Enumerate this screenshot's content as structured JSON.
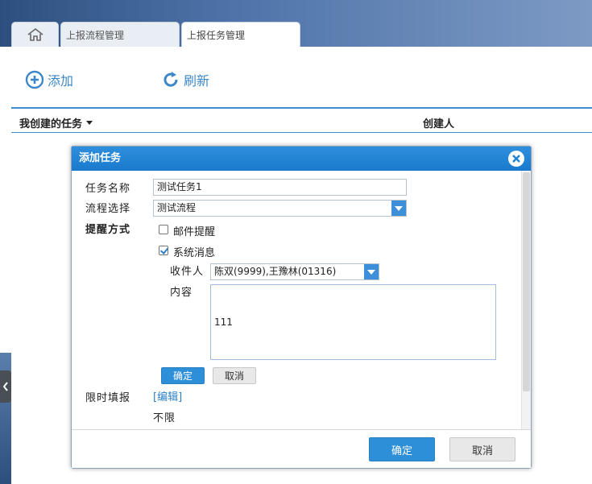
{
  "tabs": [
    {
      "label": "",
      "icon": "home-icon"
    },
    {
      "label": "上报流程管理"
    },
    {
      "label": "上报任务管理"
    }
  ],
  "toolbar": {
    "add_label": "添加",
    "refresh_label": "刷新"
  },
  "table": {
    "headers": [
      "我创建的任务",
      "创建人"
    ]
  },
  "dialog": {
    "title": "添加任务",
    "fields": {
      "task_name_label": "任务名称",
      "task_name_value": "测试任务1",
      "flow_label": "流程选择",
      "flow_value": "测试流程",
      "reminder_label": "提醒方式",
      "email_label": "邮件提醒",
      "email_checked": false,
      "system_label": "系统消息",
      "system_checked": true,
      "recipient_label": "收件人",
      "recipient_value": "陈双(9999),王豫林(01316)",
      "content_label": "内容",
      "content_value": "111"
    },
    "inner_buttons": {
      "ok": "确定",
      "cancel": "取消"
    },
    "time_limit": {
      "label": "限时填报",
      "edit_link": "[编辑]",
      "value": "不限"
    },
    "footer_buttons": {
      "ok": "确定",
      "cancel": "取消"
    }
  },
  "colors": {
    "accent": "#2e8fd9",
    "link": "#3b87c8",
    "title_bar": "#1f83d3"
  }
}
